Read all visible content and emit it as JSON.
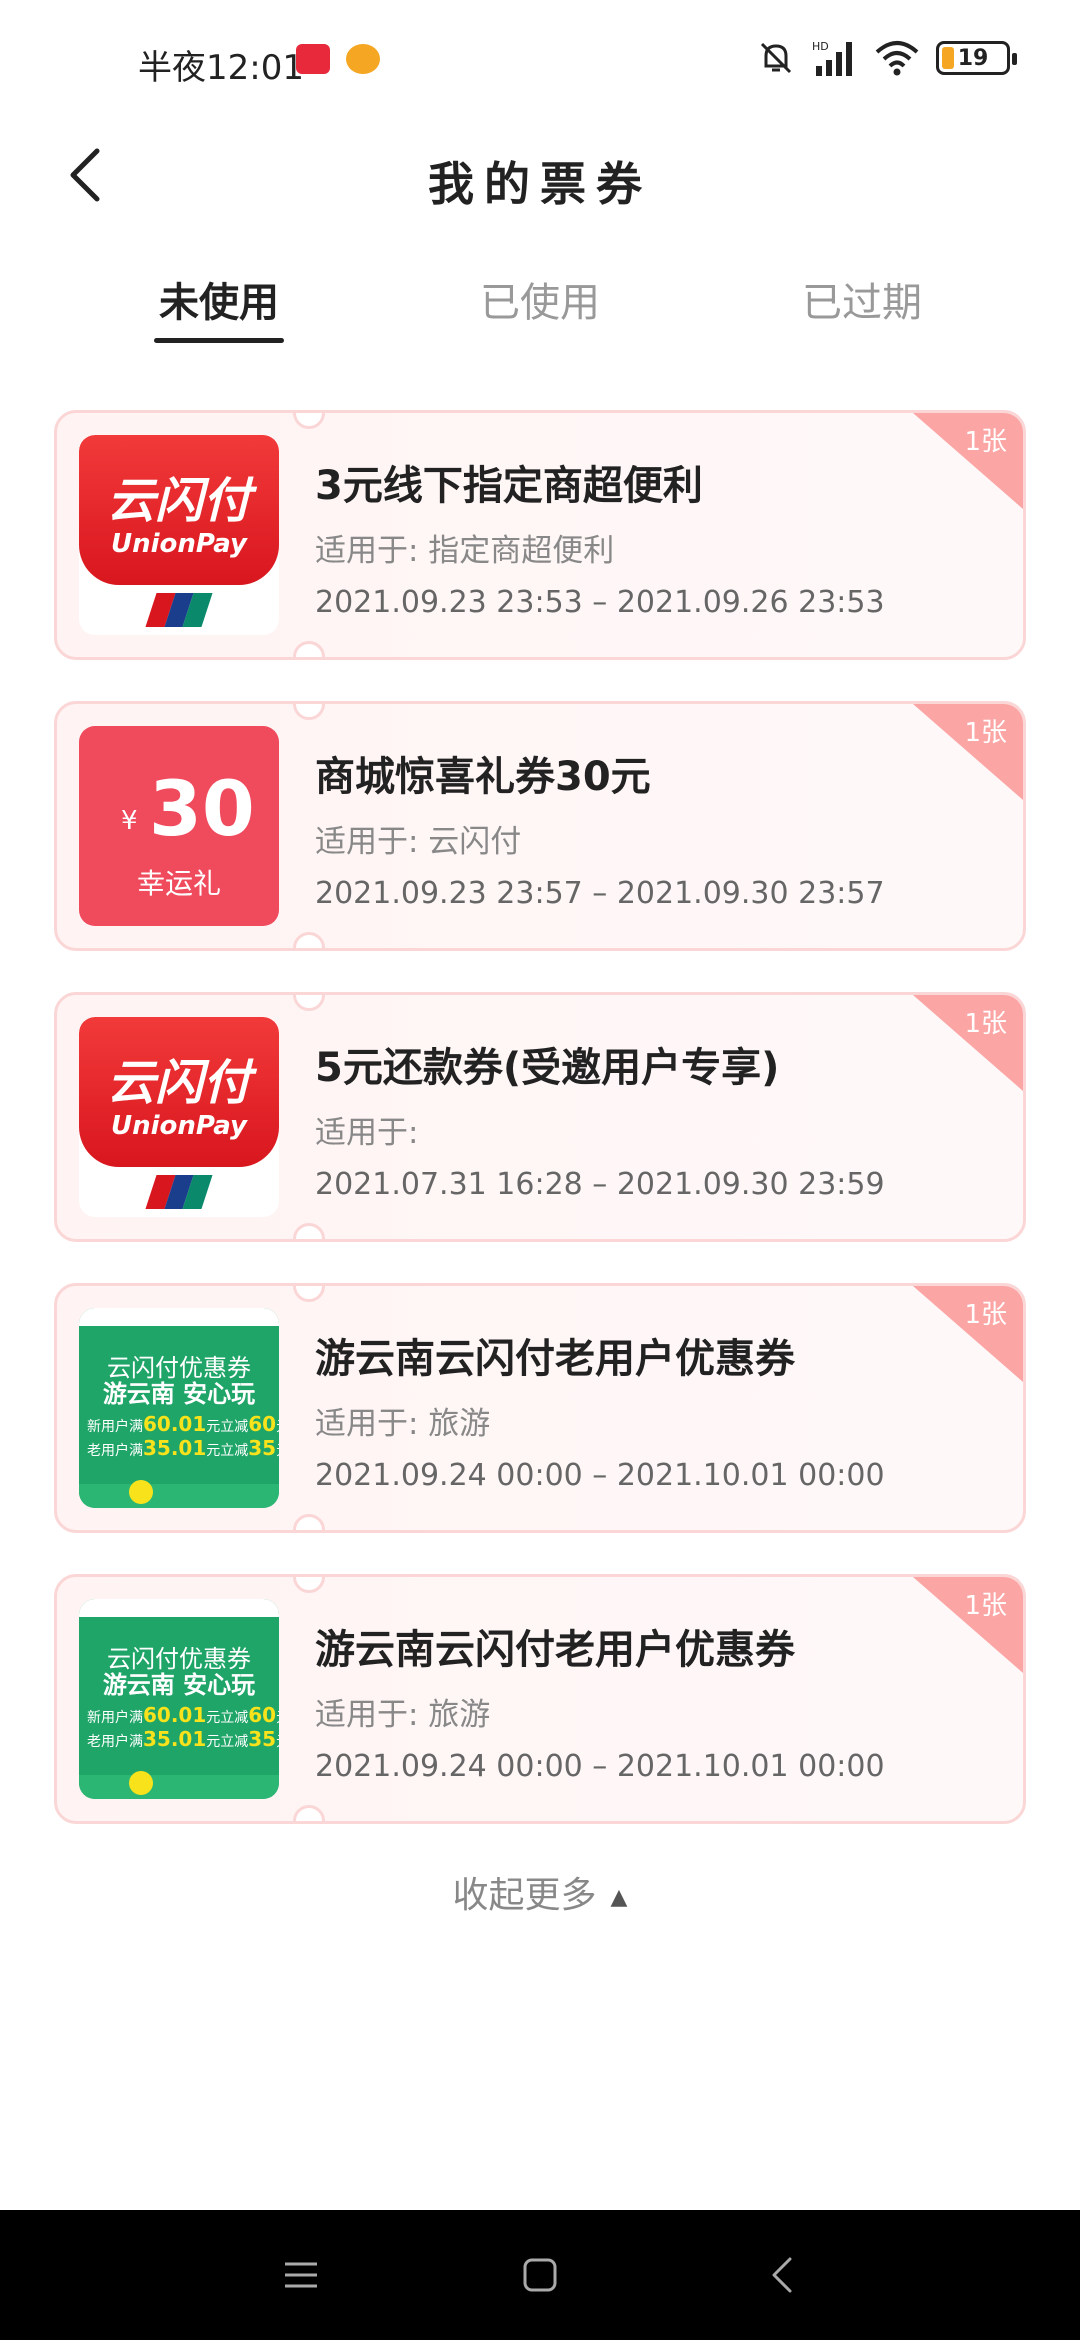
{
  "status_bar": {
    "time": "半夜12:01",
    "battery": "19"
  },
  "header": {
    "title": "我的票券"
  },
  "tabs": [
    {
      "label": "未使用"
    },
    {
      "label": "已使用"
    },
    {
      "label": "已过期"
    }
  ],
  "coupons": [
    {
      "badge": "1张",
      "title": "3元线下指定商超便利",
      "scope": "适用于: 指定商超便利",
      "date": "2021.09.23 23:53 – 2021.09.26 23:53",
      "thumb_title": "云闪付",
      "thumb_sub": "UnionPay"
    },
    {
      "badge": "1张",
      "title": "商城惊喜礼券30元",
      "scope": "适用于: 云闪付",
      "date": "2021.09.23 23:57 – 2021.09.30 23:57",
      "thumb_currency": "¥",
      "thumb_amount": "30",
      "thumb_label": "幸运礼"
    },
    {
      "badge": "1张",
      "title": "5元还款券(受邀用户专享)",
      "scope": "适用于:",
      "date": "2021.07.31 16:28 – 2021.09.30 23:59",
      "thumb_title": "云闪付",
      "thumb_sub": "UnionPay"
    },
    {
      "badge": "1张",
      "title": "游云南云闪付老用户优惠券",
      "scope": "适用于: 旅游",
      "date": "2021.09.24 00:00 – 2021.10.01 00:00",
      "thumb_title1": "云闪付优惠券",
      "thumb_title2": "游云南 安心玩",
      "thumb_line1_a": "新用户满",
      "thumb_line1_b": "60.01",
      "thumb_line1_c": "元立减",
      "thumb_line1_d": "60",
      "thumb_line1_e": "元",
      "thumb_line2_a": "老用户满",
      "thumb_line2_b": "35.01",
      "thumb_line2_c": "元立减",
      "thumb_line2_d": "35",
      "thumb_line2_e": "元"
    },
    {
      "badge": "1张",
      "title": "游云南云闪付老用户优惠券",
      "scope": "适用于: 旅游",
      "date": "2021.09.24 00:00 – 2021.10.01 00:00",
      "thumb_title1": "云闪付优惠券",
      "thumb_title2": "游云南 安心玩",
      "thumb_line1_a": "新用户满",
      "thumb_line1_b": "60.01",
      "thumb_line1_c": "元立减",
      "thumb_line1_d": "60",
      "thumb_line1_e": "元",
      "thumb_line2_a": "老用户满",
      "thumb_line2_b": "35.01",
      "thumb_line2_c": "元立减",
      "thumb_line2_d": "35",
      "thumb_line2_e": "元"
    }
  ],
  "collapse_label": "收起更多",
  "colors": {
    "accent": "#f04a5d",
    "unionpay_red": "#d8161e",
    "travel_green": "#1fa568",
    "corner": "#fca5a5"
  }
}
